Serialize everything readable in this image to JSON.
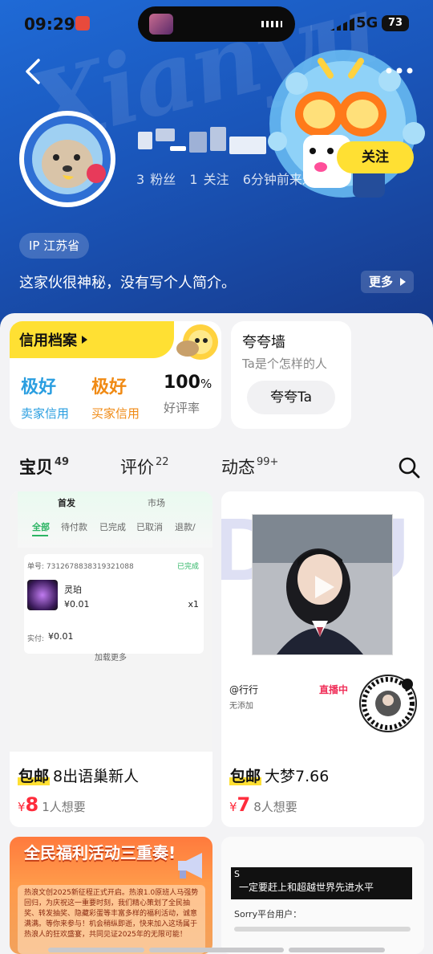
{
  "status_bar": {
    "time": "09:29",
    "network": "5G",
    "battery": "73"
  },
  "profile": {
    "followers": "3 粉丝",
    "following": "1 关注",
    "last_seen": "6分钟前来过",
    "follow_label": "关注",
    "ip": "IP 江苏省",
    "bio": "这家伙很神秘，没有写个人简介。",
    "more_label": "更多"
  },
  "credit": {
    "title": "信用档案",
    "seller_value": "极好",
    "seller_label": "卖家信用",
    "buyer_value": "极好",
    "buyer_label": "买家信用",
    "rate_value": "100",
    "rate_unit": "%",
    "rate_label": "好评率"
  },
  "praise": {
    "title": "夸夸墙",
    "subtitle": "Ta是个怎样的人",
    "button": "夸夸Ta"
  },
  "tabs": [
    {
      "label": "宝贝",
      "count": "49"
    },
    {
      "label": "评价",
      "count": "22"
    },
    {
      "label": "动态",
      "count": "99+"
    }
  ],
  "items": [
    {
      "tag": "包邮",
      "title": "8出语巢新人",
      "currency": "¥",
      "price": "8",
      "wants": "1人想要",
      "shot": {
        "top_tabs": [
          "首发",
          "市场"
        ],
        "filters": [
          "全部",
          "待付款",
          "已完成",
          "已取消",
          "退款/"
        ],
        "order_no": "单号: 7312678838319321088",
        "order_status": "已完成",
        "product": "灵珀",
        "unit_price": "¥0.01",
        "qty": "x1",
        "paid_label": "实付:",
        "paid": "¥0.01",
        "load_more": "加载更多"
      }
    },
    {
      "tag": "包邮",
      "title": "大梦7.66",
      "currency": "¥",
      "price": "7",
      "wants": "8人想要",
      "shot": {
        "user": "@行行",
        "live": "直播中",
        "note": "无添加"
      }
    }
  ],
  "bottom_cards": {
    "banner_title": "全民福利活动三重奏!",
    "banner_text": "热浪文创2025新征程正式开启。热浪1.0原班人马强势回归，为庆祝这一重要时刻，我们精心策划了全民抽奖、转发抽奖、隐藏彩蛋等丰富多样的福利活动，诚意满满。等你来参与！机会稍纵即逝，快来加入这场属于热浪人的狂欢盛宴，共同见证2025年的无限可能！",
    "doc_headline": "一定要赶上和超越世界先进水平",
    "doc_text": "Sorry平台用户："
  },
  "colors": {
    "accent": "#ffe033",
    "price": "#ff2c3c",
    "seller_credit": "#2a9ee0",
    "buyer_credit": "#f08a14",
    "hero": "#1a55b9"
  }
}
